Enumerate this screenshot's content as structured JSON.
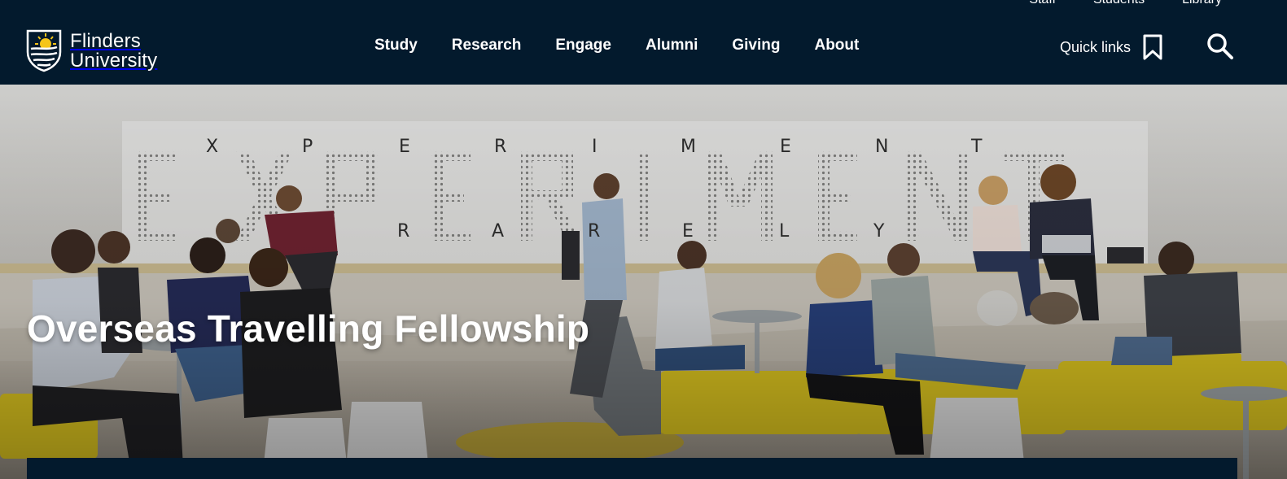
{
  "header": {
    "utility_links": [
      "Staff",
      "Students",
      "Library"
    ],
    "logo": {
      "line1": "Flinders",
      "line2": "University"
    },
    "nav": [
      "Study",
      "Research",
      "Engage",
      "Alumni",
      "Giving",
      "About"
    ],
    "quick_links_label": "Quick links",
    "icons": {
      "quick_links": "bookmark-icon",
      "search": "search-icon"
    },
    "colors": {
      "background": "#031a2d",
      "text": "#ffffff",
      "logo_sun": "#f5c518"
    }
  },
  "hero": {
    "title": "Overseas Travelling Fellowship",
    "wall_sign": {
      "big_word": "EXPERIMENT",
      "top_letters": [
        "X",
        "P",
        "E",
        "R",
        "I",
        "M",
        "E",
        "N",
        "T"
      ],
      "bottom_letters": [
        "R",
        "A",
        "R",
        "E",
        "L",
        "Y"
      ]
    },
    "colors": {
      "seats": "#d9c21f",
      "bottom_bar": "#031a2d"
    }
  }
}
